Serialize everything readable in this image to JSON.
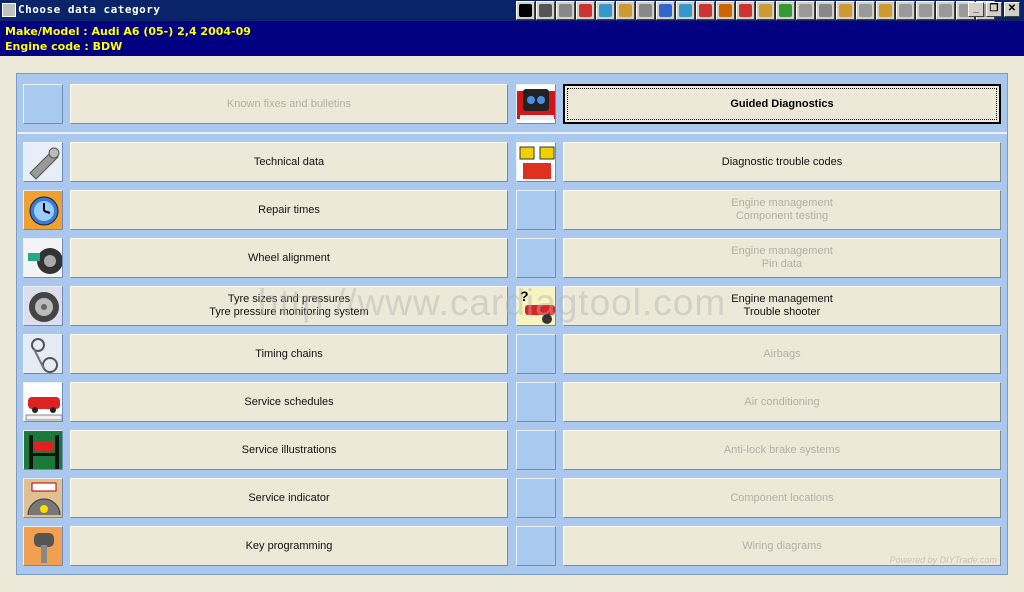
{
  "window": {
    "title": "Choose data category",
    "minimize": "_",
    "restore": "❐",
    "close": "✕"
  },
  "vehicle": {
    "make_model": "Make/Model  : Audi   A6 (05-) 2,4  2004-09",
    "engine_code": "Engine code  : BDW"
  },
  "toolbar_icons": [
    "first-icon",
    "back-icon",
    "warning-icon",
    "flag-icon",
    "vehicle-icon",
    "engine-icon",
    "gear-icon",
    "wheel-icon",
    "tool-icon",
    "battery-icon",
    "lift-icon",
    "book-icon",
    "key-icon",
    "fuel-icon",
    "doc-icon",
    "settings-icon",
    "timer-icon",
    "pump-icon",
    "jack-icon",
    "person-icon",
    "warning2-icon",
    "car-icon",
    "chain-icon",
    "print-icon"
  ],
  "top_row": {
    "left_label": "Known fixes and bulletins",
    "right_label": "Guided Diagnostics"
  },
  "left_items": [
    {
      "label": "Technical data",
      "icon": "spanner-icon",
      "disabled": false
    },
    {
      "label": "Repair times",
      "icon": "clock-icon",
      "disabled": false
    },
    {
      "label": "Wheel alignment",
      "icon": "wheel-alignment-icon",
      "disabled": false
    },
    {
      "label": "Tyre sizes and pressures\nTyre pressure monitoring system",
      "icon": "tyre-icon",
      "disabled": false
    },
    {
      "label": "Timing chains",
      "icon": "timing-chain-icon",
      "disabled": false
    },
    {
      "label": "Service schedules",
      "icon": "service-car-icon",
      "disabled": false
    },
    {
      "label": "Service illustrations",
      "icon": "lift-icon",
      "disabled": false
    },
    {
      "label": "Service indicator",
      "icon": "serv-indicator-icon",
      "disabled": false
    },
    {
      "label": "Key programming",
      "icon": "key-icon",
      "disabled": false
    }
  ],
  "right_items": [
    {
      "label": "Diagnostic trouble codes",
      "icon": "dtc-icon",
      "disabled": false,
      "has_icon": true
    },
    {
      "label": "Engine management\nComponent testing",
      "icon": "",
      "disabled": true,
      "has_icon": false
    },
    {
      "label": "Engine management\nPin data",
      "icon": "",
      "disabled": true,
      "has_icon": false
    },
    {
      "label": "Engine management\nTrouble shooter",
      "icon": "trouble-shooter-icon",
      "disabled": false,
      "has_icon": true
    },
    {
      "label": "Airbags",
      "icon": "",
      "disabled": true,
      "has_icon": false
    },
    {
      "label": "Air conditioning",
      "icon": "",
      "disabled": true,
      "has_icon": false
    },
    {
      "label": "Anti-lock brake systems",
      "icon": "",
      "disabled": true,
      "has_icon": false
    },
    {
      "label": "Component locations",
      "icon": "",
      "disabled": true,
      "has_icon": false
    },
    {
      "label": "Wiring diagrams",
      "icon": "",
      "disabled": true,
      "has_icon": false
    }
  ],
  "watermark": "http://www.cardiagtool.com",
  "footer": "Powered by DIYTrade.com"
}
